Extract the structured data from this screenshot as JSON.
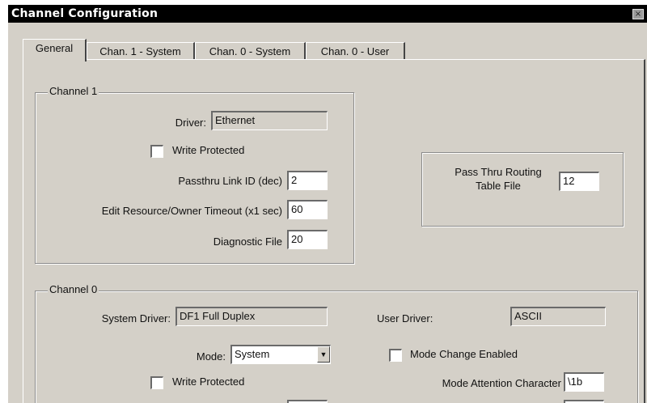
{
  "window": {
    "title": "Channel Configuration",
    "close_glyph": "×"
  },
  "tabs": [
    {
      "label": "General"
    },
    {
      "label": "Chan. 1 - System"
    },
    {
      "label": "Chan. 0 - System"
    },
    {
      "label": "Chan. 0 - User"
    }
  ],
  "channel1": {
    "group_label": "Channel 1",
    "driver_label": "Driver:",
    "driver_value": "Ethernet",
    "write_protected_label": "Write Protected",
    "passthru_label": "Passthru Link ID (dec)",
    "passthru_value": "2",
    "edit_timeout_label": "Edit Resource/Owner Timeout (x1 sec)",
    "edit_timeout_value": "60",
    "diag_label": "Diagnostic File",
    "diag_value": "20"
  },
  "passthru_routing": {
    "label_line1": "Pass Thru Routing",
    "label_line2": "Table File",
    "value": "12"
  },
  "channel0": {
    "group_label": "Channel 0",
    "system_driver_label": "System Driver:",
    "system_driver_value": "DF1 Full Duplex",
    "user_driver_label": "User Driver:",
    "user_driver_value": "ASCII",
    "mode_label": "Mode:",
    "mode_value": "System",
    "mode_change_label": "Mode Change Enabled",
    "write_protected_label": "Write Protected",
    "mode_attention_label": "Mode Attention Character",
    "mode_attention_value": "\\1b"
  },
  "icons": {
    "dropdown": "chevron-down-icon"
  }
}
